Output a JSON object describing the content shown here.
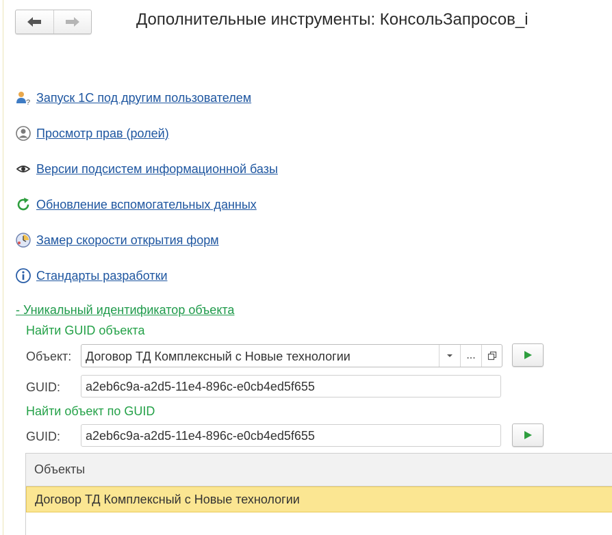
{
  "header": {
    "title": "Дополнительные инструменты: КонсольЗапросов_i",
    "back_icon": "arrow-left-icon",
    "forward_icon": "arrow-right-icon"
  },
  "commands": [
    {
      "label": "Запуск 1С под другим пользователем",
      "icon": "user-question-icon"
    },
    {
      "label": "Просмотр прав (ролей)",
      "icon": "user-circle-icon"
    },
    {
      "label": "Версии подсистем информационной базы",
      "icon": "eye-icon"
    },
    {
      "label": "Обновление вспомогательных данных",
      "icon": "refresh-icon"
    },
    {
      "label": "Замер скорости открытия форм",
      "icon": "clock-globe-icon"
    },
    {
      "label": "Стандарты разработки",
      "icon": "info-icon"
    }
  ],
  "guid_group": {
    "toggle_label": "- Уникальный идентификатор объекта",
    "find_guid": {
      "title": "Найти GUID объекта",
      "object_label": "Объект:",
      "object_value": "Договор ТД Комплексный с Новые технологии",
      "dropdown_icon": "chevron-down-icon",
      "ellipsis_label": "...",
      "open_icon": "open-window-icon",
      "guid_label": "GUID:",
      "guid_value": "a2eb6c9a-a2d5-11e4-896c-e0cb4ed5f655",
      "run_icon": "play-icon"
    },
    "find_object": {
      "title": "Найти объект по GUID",
      "guid_label": "GUID:",
      "guid_value": "a2eb6c9a-a2d5-11e4-896c-e0cb4ed5f655",
      "run_icon": "play-icon"
    },
    "objects_table": {
      "header": "Объекты",
      "rows": [
        "Договор ТД Комплексный с Новые технологии"
      ]
    }
  },
  "colors": {
    "link": "#1e56a0",
    "group_green": "#24a148",
    "selected_row": "#fbe692",
    "play_green": "#2e9e3e"
  }
}
